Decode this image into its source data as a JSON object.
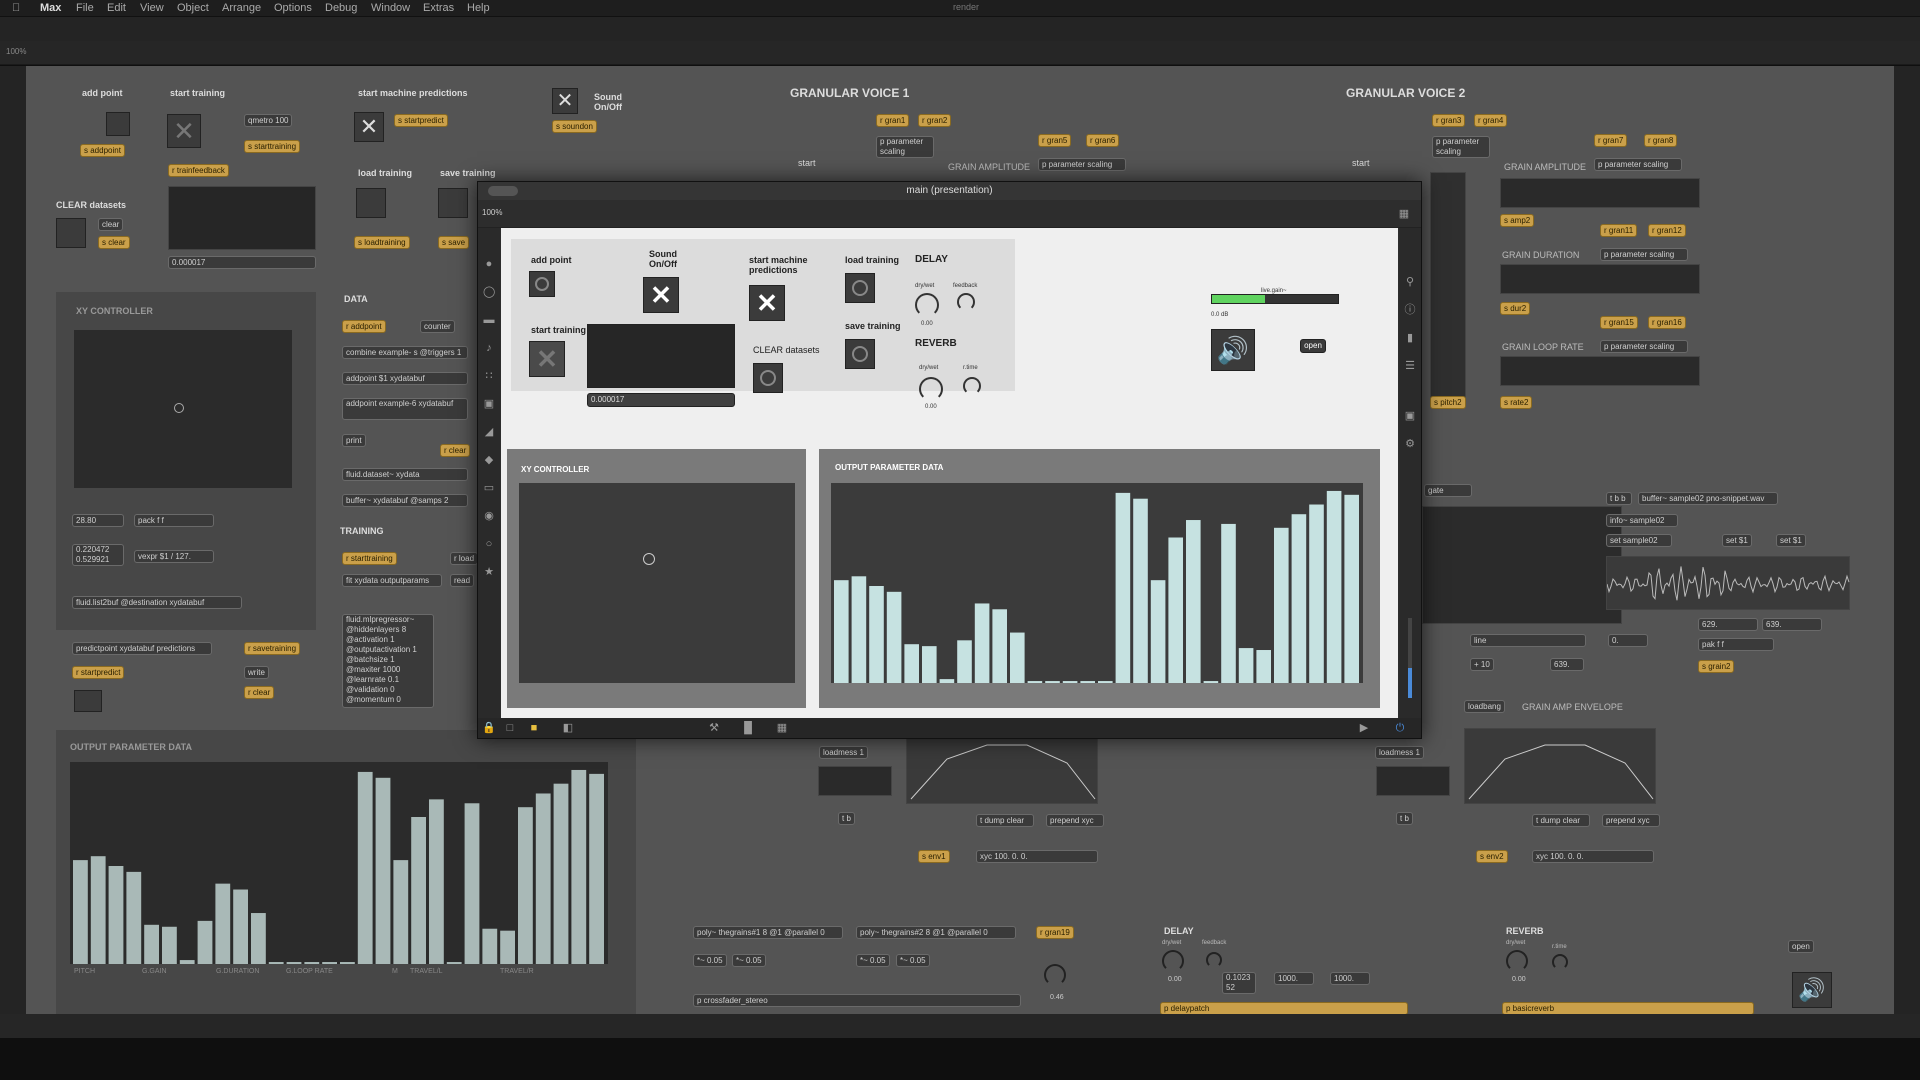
{
  "menubar": {
    "items": [
      "Max",
      "File",
      "Edit",
      "View",
      "Object",
      "Arrange",
      "Options",
      "Debug",
      "Window",
      "Extras",
      "Help"
    ],
    "doc_title": "render"
  },
  "patcher": {
    "zoom": "100%",
    "labels": {
      "add_point": "add point",
      "start_training": "start training",
      "start_machine_predictions": "start machine predictions",
      "sound_onoff": "Sound On/Off",
      "load_training": "load training",
      "save_training": "save training",
      "clear_datasets": "CLEAR datasets",
      "xy_controller": "XY CONTROLLER",
      "data": "DATA",
      "training": "TRAINING",
      "output_parameter_data": "OUTPUT PARAMETER DATA",
      "granular_voice_1": "GRANULAR VOICE 1",
      "granular_voice_2": "GRANULAR VOICE 2",
      "grain_amplitude": "GRAIN AMPLITUDE",
      "grain_duration": "GRAIN DURATION",
      "grain_loop_rate": "GRAIN LOOP RATE",
      "grain_amp_envelope": "GRAIN AMP ENVELOPE",
      "start": "start",
      "delay": "DELAY",
      "reverb": "REVERB",
      "dry_wet": "dry/wet",
      "feedback": "feedback",
      "rtime": "r.time",
      "axis_labels": [
        "PITCH",
        "G.GAIN",
        "G.DURATION",
        "G.LOOP RATE",
        "M",
        "TRAVEL/L",
        "TRAVEL/R"
      ]
    },
    "objects": {
      "s_addpoint": "s addpoint",
      "qmetro": "qmetro 100",
      "s_starttraining": "s starttraining",
      "r_trainfeedback": "r trainfeedback",
      "s_startpredict": "s startpredict",
      "s_soundon": "s soundon",
      "clear": "clear",
      "s_clear": "s clear",
      "s_loadtraining": "s loadtraining",
      "s_save": "s save",
      "number_main": "0.000017",
      "r_addpoint": "r addpoint",
      "counter": "counter",
      "combine": "combine example- s @triggers 1",
      "addpoint1": "addpoint $1 xydatabuf",
      "addpoint_example": "addpoint example-6 xydatabuf",
      "print": "print",
      "r_clear": "r clear",
      "fluid_dataset": "fluid.dataset~ xydata",
      "buffer_xy": "buffer~ xydatabuf @samps 2",
      "r_starttraining": "r starttraining",
      "r_load": "r load",
      "fit": "fit xydata outputparams",
      "read": "read",
      "mlp": "fluid.mlpregressor~ @hiddenlayers 8 @activation 1 @outputactivation 1 @batchsize 1 @maxiter 1000 @learnrate 0.1 @validation 0 @momentum 0",
      "xy_num1": "28.80",
      "pack": "pack f f",
      "xy_num2": "0.220472 0.529921",
      "vexpr": "vexpr $1 / 127.",
      "fluid_list2buf": "fluid.list2buf @destination xydatabuf",
      "predict": "predictpoint xydatabuf predictions",
      "r_savetraining": "r savetraining",
      "r_startpredict": "r startpredict",
      "write": "write",
      "r_clear2": "r clear",
      "r_gran1": "r gran1",
      "r_gran2": "r gran2",
      "r_gran3": "r gran3",
      "r_gran4": "r gran4",
      "r_gran5": "r gran5",
      "r_gran6": "r gran6",
      "r_gran7": "r gran7",
      "r_gran8": "r gran8",
      "r_gran11": "r gran11",
      "r_gran12": "r gran12",
      "r_gran15": "r gran15",
      "r_gran16": "r gran16",
      "p_param_scaling": "p parameter scaling",
      "s_amp2": "s amp2",
      "s_dur2": "s dur2",
      "s_rate2": "s rate2",
      "s_pitch2": "s pitch2",
      "gate": "gate",
      "tbb": "t b b",
      "buffer_sample": "buffer~ sample02 pno-snippet.wav",
      "info_sample": "info~ sample02",
      "set_sample": "set sample02",
      "set1a": "set $1",
      "set1b": "set $1",
      "line": "line",
      "num0": "0.",
      "plus10": "+ 10",
      "n639a": "639.",
      "n629": "629.",
      "n639b": "639.",
      "pakff": "pak f f",
      "s_grain2": "s grain2",
      "loadbang": "loadbang",
      "loadmess1": "loadmess 1",
      "loadmess1b": "loadmess 1",
      "tb1": "t b",
      "tb2": "t b",
      "dump_clear1": "t dump clear",
      "prepend_xyc1": "prepend xyc",
      "dump_clear2": "t dump clear",
      "prepend_xyc2": "prepend xyc",
      "s_env1": "s env1",
      "s_env2": "s env2",
      "xyc1": "xyc 100. 0. 0.",
      "xyc2": "xyc 100. 0. 0.",
      "poly1": "poly~ thegrains#1 8 @1 @parallel 0",
      "poly2": "poly~ thegrains#2 8 @1 @parallel 0",
      "r_gran19": "r gran19",
      "mul1": "*~ 0.05",
      "mul2": "*~ 0.05",
      "mul3": "*~ 0.05",
      "mul4": "*~ 0.05",
      "crossfader": "p crossfader_stereo",
      "val046": "0.46",
      "val_b": "0.1023 52",
      "n1000a": "1000.",
      "n1000b": "1000.",
      "delaypatch": "p delaypatch",
      "basicreverb": "p basicreverb",
      "open": "open",
      "dial_000": "0.00"
    }
  },
  "window": {
    "title": "main (presentation)",
    "zoom": "100%"
  },
  "presentation": {
    "add_point": "add point",
    "sound_onoff": "Sound On/Off",
    "start_machine_predictions": "start machine predictions",
    "load_training": "load training",
    "save_training": "save training",
    "start_training": "start training",
    "clear_datasets": "CLEAR datasets",
    "number_value": "0.000017",
    "delay": "DELAY",
    "reverb": "REVERB",
    "dry_wet": "dry/wet",
    "feedback": "feedback",
    "rtime": "r.time",
    "dial_value": "0.00",
    "gain_label": "live.gain~",
    "gain_db": "0.0 dB",
    "open": "open",
    "xy_title": "XY CONTROLLER",
    "output_title": "OUTPUT PARAMETER DATA"
  },
  "colors": {
    "bars": "#c6e2e1",
    "gain_green": "#5fd35f",
    "canvas": "#545454",
    "presentation": "#efefef"
  },
  "icons": {
    "close": "x-icon",
    "speaker": "speaker-icon",
    "lock": "lock-icon"
  },
  "chart_data": [
    {
      "type": "bar",
      "title": "OUTPUT PARAMETER DATA",
      "values": [
        0.53,
        0.55,
        0.5,
        0.47,
        0.2,
        0.19,
        0.02,
        0.22,
        0.41,
        0.38,
        0.26,
        0.01,
        0.01,
        0.01,
        0.01,
        0.01,
        0.98,
        0.95,
        0.53,
        0.75,
        0.84,
        0.01,
        0.82,
        0.18,
        0.17,
        0.8,
        0.87,
        0.92,
        0.99,
        0.97
      ],
      "ylim": [
        0,
        1
      ]
    },
    {
      "type": "bar",
      "title": "OUTPUT PARAMETER DATA",
      "values": [
        0.53,
        0.55,
        0.5,
        0.47,
        0.2,
        0.19,
        0.02,
        0.22,
        0.41,
        0.38,
        0.26,
        0.01,
        0.01,
        0.01,
        0.01,
        0.01,
        0.98,
        0.95,
        0.53,
        0.75,
        0.84,
        0.01,
        0.82,
        0.18,
        0.17,
        0.8,
        0.87,
        0.92,
        0.99,
        0.97
      ],
      "ylim": [
        0,
        1
      ]
    }
  ],
  "gain_level": 0.42,
  "xy_point": [
    0.47,
    0.38
  ]
}
